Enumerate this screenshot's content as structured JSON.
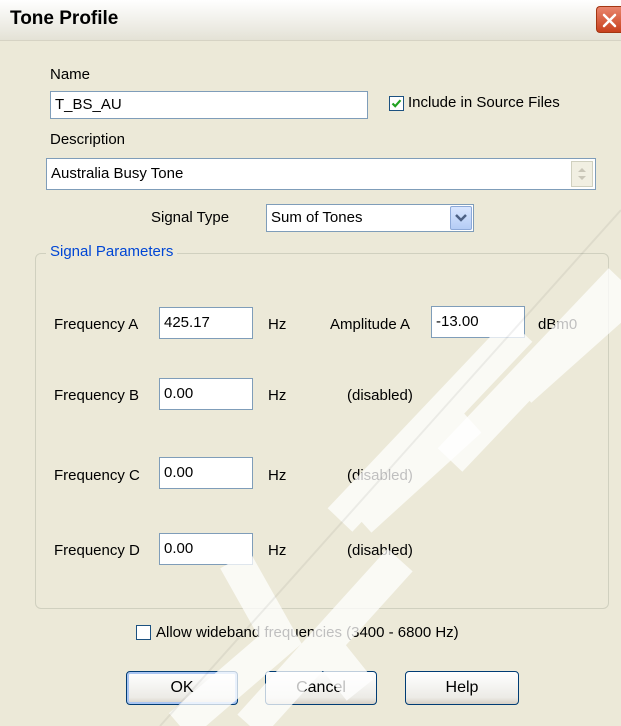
{
  "window": {
    "title": "Tone Profile"
  },
  "name": {
    "label": "Name",
    "value": "T_BS_AU"
  },
  "include_source": {
    "label": "Include in Source Files",
    "checked": true
  },
  "description": {
    "label": "Description",
    "value": "Australia Busy Tone"
  },
  "signal_type": {
    "label": "Signal Type",
    "value": "Sum of Tones"
  },
  "signal_params": {
    "title": "Signal Parameters",
    "rows": [
      {
        "freq_label": "Frequency A",
        "freq_value": "425.17",
        "unit": "Hz",
        "amp_label": "Amplitude A",
        "amp_value": "-13.00",
        "amp_unit": "dBm0"
      },
      {
        "freq_label": "Frequency B",
        "freq_value": "0.00",
        "unit": "Hz",
        "status": "(disabled)"
      },
      {
        "freq_label": "Frequency C",
        "freq_value": "0.00",
        "unit": "Hz",
        "status": "(disabled)"
      },
      {
        "freq_label": "Frequency D",
        "freq_value": "0.00",
        "unit": "Hz",
        "status": "(disabled)"
      }
    ]
  },
  "wideband": {
    "label": "Allow wideband frequencies (3400 - 6800 Hz)",
    "checked": false
  },
  "buttons": {
    "ok": "OK",
    "cancel": "Cancel",
    "help": "Help"
  },
  "colors": {
    "group_title": "#0046d5",
    "dialog_bg": "#ece9d8",
    "checkmark": "#21a121"
  }
}
